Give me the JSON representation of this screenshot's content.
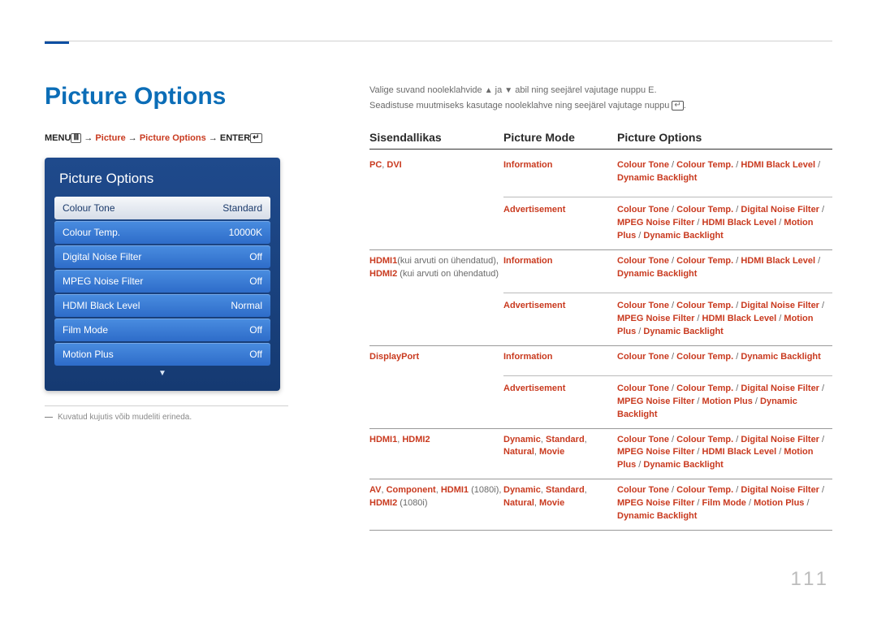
{
  "page_number": "111",
  "section_title": "Picture Options",
  "breadcrumb": {
    "menu": "MENU",
    "arrow": " → ",
    "p1": "Picture",
    "p2": "Picture Options",
    "enter": "ENTER"
  },
  "panel": {
    "title": "Picture Options",
    "rows": [
      {
        "label": "Colour Tone",
        "value": "Standard",
        "selected": true
      },
      {
        "label": "Colour Temp.",
        "value": "10000K",
        "selected": false
      },
      {
        "label": "Digital Noise Filter",
        "value": "Off",
        "selected": false
      },
      {
        "label": "MPEG Noise Filter",
        "value": "Off",
        "selected": false
      },
      {
        "label": "HDMI Black Level",
        "value": "Normal",
        "selected": false
      },
      {
        "label": "Film Mode",
        "value": "Off",
        "selected": false
      },
      {
        "label": "Motion Plus",
        "value": "Off",
        "selected": false
      }
    ]
  },
  "footnote": "Kuvatud kujutis võib mudeliti erineda.",
  "intro": {
    "line1a": "Valige suvand nooleklahvide ",
    "line1b": " ja ",
    "line1c": " abil ning seejärel vajutage nuppu E.",
    "line2a": "Seadistuse muutmiseks kasutage nooleklahve ning seejärel vajutage nuppu ",
    "line2b": "."
  },
  "table": {
    "headers": {
      "c1": "Sisendallikas",
      "c2": "Picture Mode",
      "c3": "Picture Options"
    },
    "groups": [
      {
        "col1_parts": [
          {
            "text": "PC",
            "red": true
          },
          {
            "text": ", ",
            "red": false
          },
          {
            "text": "DVI",
            "red": true
          }
        ],
        "rows": [
          {
            "col2_parts": [
              {
                "text": "Information",
                "red": true
              }
            ],
            "col3_parts": [
              {
                "text": "Colour Tone",
                "red": true
              },
              {
                "text": " / ",
                "red": false
              },
              {
                "text": "Colour Temp.",
                "red": true
              },
              {
                "text": " / ",
                "red": false
              },
              {
                "text": "HDMI Black Level",
                "red": true
              },
              {
                "text": " / ",
                "red": false
              },
              {
                "text": "Dynamic Backlight",
                "red": true
              }
            ]
          },
          {
            "col2_parts": [
              {
                "text": "Advertisement",
                "red": true
              }
            ],
            "col3_parts": [
              {
                "text": "Colour Tone",
                "red": true
              },
              {
                "text": " / ",
                "red": false
              },
              {
                "text": "Colour Temp.",
                "red": true
              },
              {
                "text": " / ",
                "red": false
              },
              {
                "text": "Digital Noise Filter",
                "red": true
              },
              {
                "text": " / ",
                "red": false
              },
              {
                "text": "MPEG Noise Filter",
                "red": true
              },
              {
                "text": " / ",
                "red": false
              },
              {
                "text": "HDMI Black Level",
                "red": true
              },
              {
                "text": " / ",
                "red": false
              },
              {
                "text": "Motion Plus",
                "red": true
              },
              {
                "text": " / ",
                "red": false
              },
              {
                "text": "Dynamic Backlight",
                "red": true
              }
            ]
          }
        ]
      },
      {
        "col1_parts": [
          {
            "text": "HDMI1",
            "red": true
          },
          {
            "text": "(kui arvuti on ühendatud), ",
            "red": false
          },
          {
            "text": "HDMI2",
            "red": true
          },
          {
            "text": " (kui arvuti on ühendatud)",
            "red": false
          }
        ],
        "rows": [
          {
            "col2_parts": [
              {
                "text": "Information",
                "red": true
              }
            ],
            "col3_parts": [
              {
                "text": "Colour Tone",
                "red": true
              },
              {
                "text": " / ",
                "red": false
              },
              {
                "text": "Colour Temp.",
                "red": true
              },
              {
                "text": " / ",
                "red": false
              },
              {
                "text": "HDMI Black Level",
                "red": true
              },
              {
                "text": " / ",
                "red": false
              },
              {
                "text": "Dynamic Backlight",
                "red": true
              }
            ]
          },
          {
            "col2_parts": [
              {
                "text": "Advertisement",
                "red": true
              }
            ],
            "col3_parts": [
              {
                "text": "Colour Tone",
                "red": true
              },
              {
                "text": " / ",
                "red": false
              },
              {
                "text": "Colour Temp.",
                "red": true
              },
              {
                "text": " / ",
                "red": false
              },
              {
                "text": "Digital Noise Filter",
                "red": true
              },
              {
                "text": " / ",
                "red": false
              },
              {
                "text": "MPEG Noise Filter",
                "red": true
              },
              {
                "text": " / ",
                "red": false
              },
              {
                "text": "HDMI Black Level",
                "red": true
              },
              {
                "text": " / ",
                "red": false
              },
              {
                "text": "Motion Plus",
                "red": true
              },
              {
                "text": " / ",
                "red": false
              },
              {
                "text": "Dynamic Backlight",
                "red": true
              }
            ]
          }
        ]
      },
      {
        "col1_parts": [
          {
            "text": "DisplayPort",
            "red": true
          }
        ],
        "rows": [
          {
            "col2_parts": [
              {
                "text": "Information",
                "red": true
              }
            ],
            "col3_parts": [
              {
                "text": "Colour Tone",
                "red": true
              },
              {
                "text": " / ",
                "red": false
              },
              {
                "text": "Colour Temp.",
                "red": true
              },
              {
                "text": " / ",
                "red": false
              },
              {
                "text": "Dynamic Backlight",
                "red": true
              }
            ]
          },
          {
            "col2_parts": [
              {
                "text": "Advertisement",
                "red": true
              }
            ],
            "col3_parts": [
              {
                "text": "Colour Tone",
                "red": true
              },
              {
                "text": " / ",
                "red": false
              },
              {
                "text": "Colour Temp.",
                "red": true
              },
              {
                "text": " / ",
                "red": false
              },
              {
                "text": "Digital Noise Filter",
                "red": true
              },
              {
                "text": " / ",
                "red": false
              },
              {
                "text": "MPEG Noise Filter",
                "red": true
              },
              {
                "text": " / ",
                "red": false
              },
              {
                "text": "Motion Plus",
                "red": true
              },
              {
                "text": " / ",
                "red": false
              },
              {
                "text": "Dynamic Backlight",
                "red": true
              }
            ]
          }
        ]
      },
      {
        "col1_parts": [
          {
            "text": "HDMI1",
            "red": true
          },
          {
            "text": ", ",
            "red": false
          },
          {
            "text": "HDMI2",
            "red": true
          }
        ],
        "rows": [
          {
            "col2_parts": [
              {
                "text": "Dynamic",
                "red": true
              },
              {
                "text": ", ",
                "red": false
              },
              {
                "text": "Standard",
                "red": true
              },
              {
                "text": ", ",
                "red": false
              },
              {
                "text": "Natural",
                "red": true
              },
              {
                "text": ", ",
                "red": false
              },
              {
                "text": "Movie",
                "red": true
              }
            ],
            "col3_parts": [
              {
                "text": "Colour Tone",
                "red": true
              },
              {
                "text": " / ",
                "red": false
              },
              {
                "text": "Colour Temp.",
                "red": true
              },
              {
                "text": " / ",
                "red": false
              },
              {
                "text": "Digital Noise Filter",
                "red": true
              },
              {
                "text": " / ",
                "red": false
              },
              {
                "text": "MPEG Noise Filter",
                "red": true
              },
              {
                "text": " / ",
                "red": false
              },
              {
                "text": "HDMI Black Level",
                "red": true
              },
              {
                "text": " / ",
                "red": false
              },
              {
                "text": "Motion Plus",
                "red": true
              },
              {
                "text": " / ",
                "red": false
              },
              {
                "text": "Dynamic Backlight",
                "red": true
              }
            ]
          }
        ]
      },
      {
        "col1_parts": [
          {
            "text": "AV",
            "red": true
          },
          {
            "text": ", ",
            "red": false
          },
          {
            "text": "Component",
            "red": true
          },
          {
            "text": ", ",
            "red": false
          },
          {
            "text": "HDMI1",
            "red": true
          },
          {
            "text": " (1080i), ",
            "red": false
          },
          {
            "text": "HDMI2",
            "red": true
          },
          {
            "text": " (1080i)",
            "red": false
          }
        ],
        "rows": [
          {
            "col2_parts": [
              {
                "text": "Dynamic",
                "red": true
              },
              {
                "text": ", ",
                "red": false
              },
              {
                "text": "Standard",
                "red": true
              },
              {
                "text": ", ",
                "red": false
              },
              {
                "text": "Natural",
                "red": true
              },
              {
                "text": ", ",
                "red": false
              },
              {
                "text": "Movie",
                "red": true
              }
            ],
            "col3_parts": [
              {
                "text": "Colour Tone",
                "red": true
              },
              {
                "text": " / ",
                "red": false
              },
              {
                "text": "Colour Temp.",
                "red": true
              },
              {
                "text": " / ",
                "red": false
              },
              {
                "text": "Digital Noise Filter",
                "red": true
              },
              {
                "text": " / ",
                "red": false
              },
              {
                "text": "MPEG Noise Filter",
                "red": true
              },
              {
                "text": " / ",
                "red": false
              },
              {
                "text": "Film Mode",
                "red": true
              },
              {
                "text": " / ",
                "red": false
              },
              {
                "text": "Motion Plus",
                "red": true
              },
              {
                "text": " / ",
                "red": false
              },
              {
                "text": "Dynamic Backlight",
                "red": true
              }
            ]
          }
        ]
      }
    ]
  }
}
